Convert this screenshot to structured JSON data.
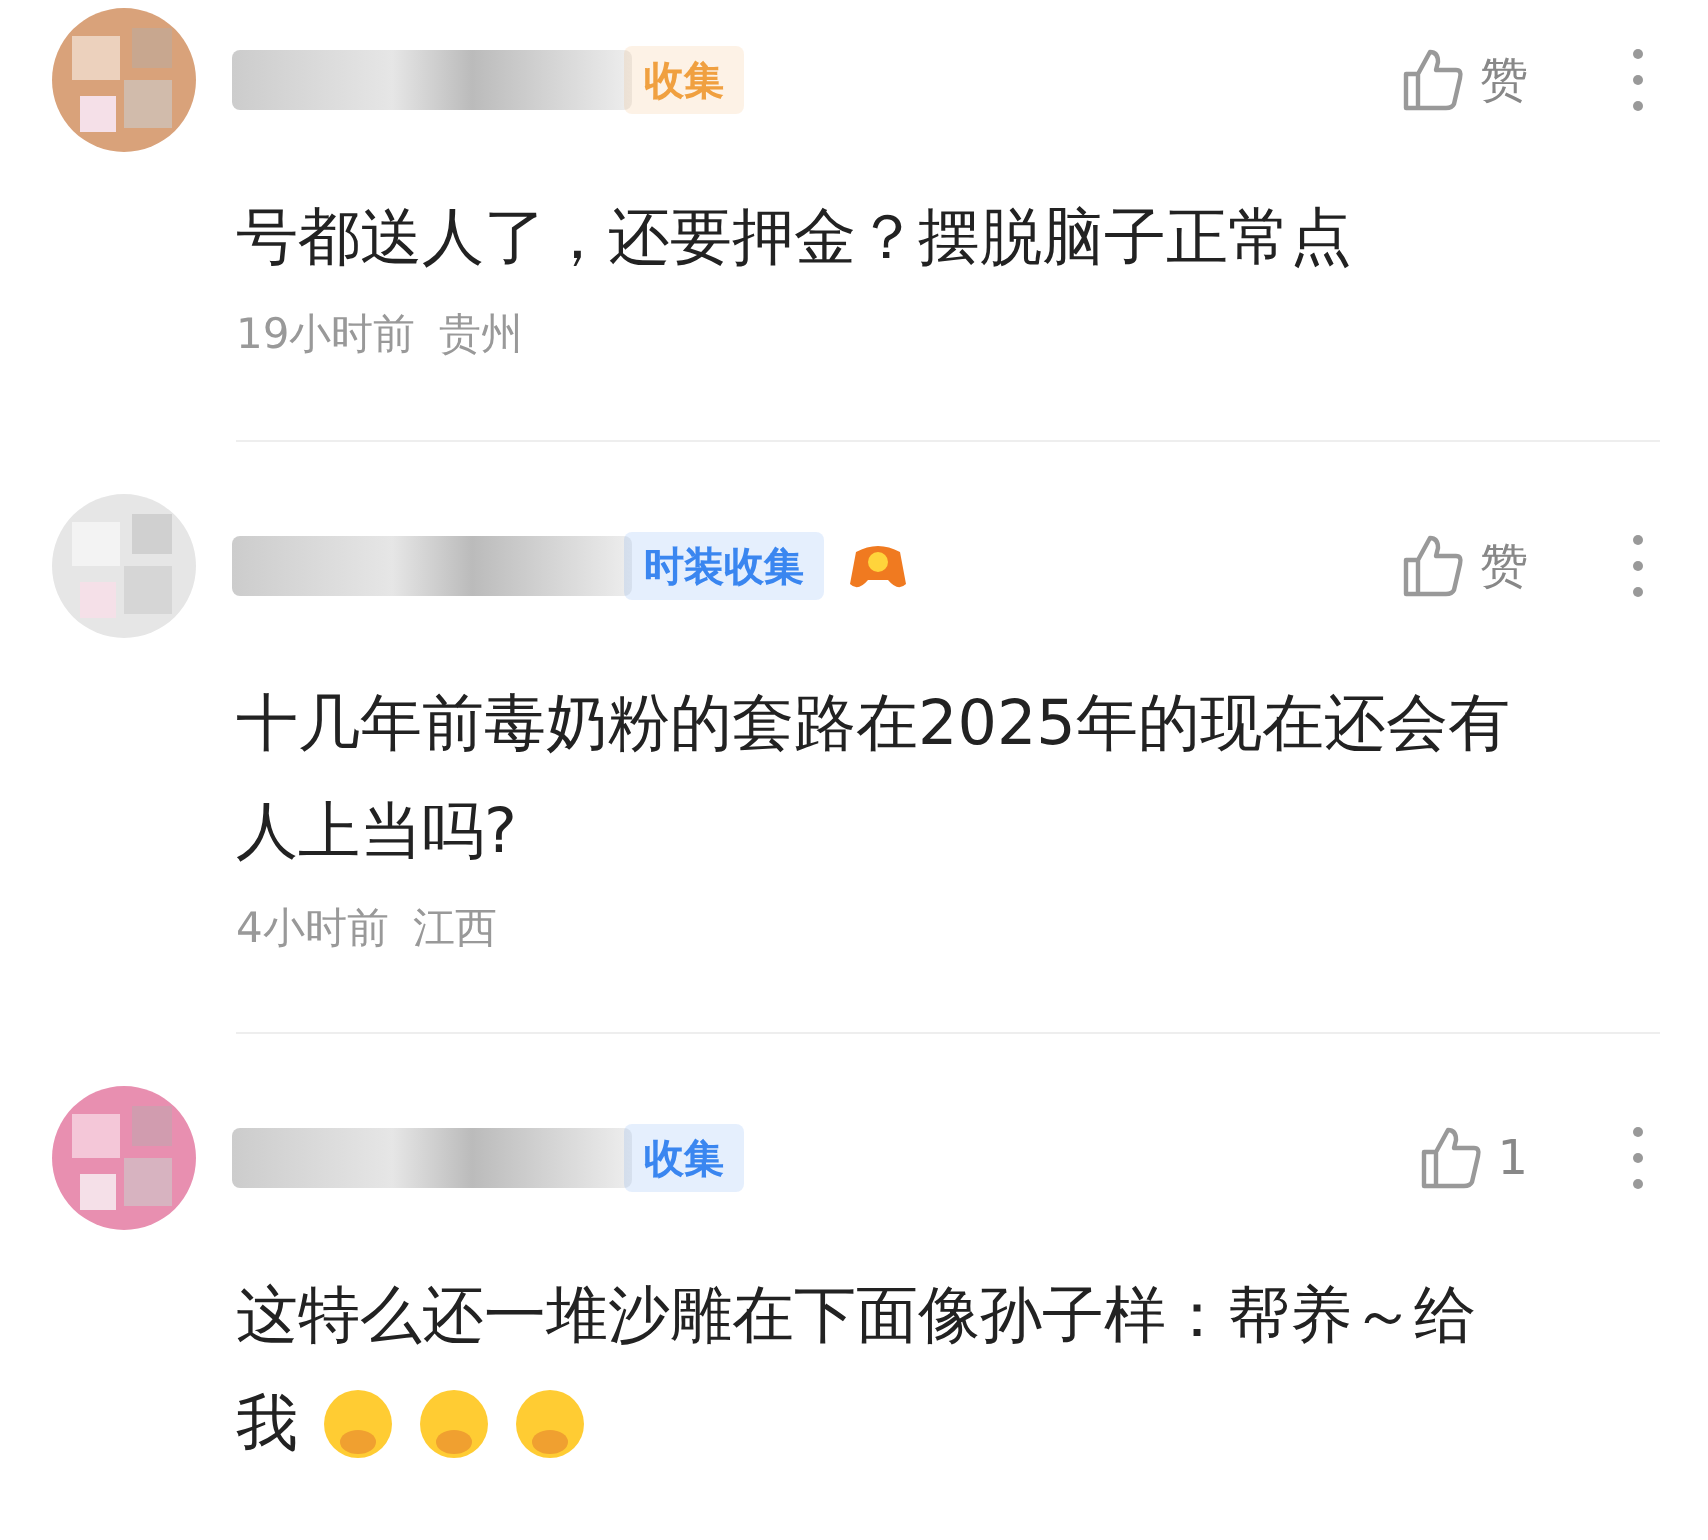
{
  "comments": [
    {
      "badge": {
        "text": "收集",
        "color": "#f0a040"
      },
      "medal": false,
      "like": {
        "label": "赞"
      },
      "lines": [
        "号都送人了，还要押金？摆脱脑子正常点"
      ],
      "time": "19小时前",
      "region": "贵州"
    },
    {
      "badge": {
        "text": "时装收集",
        "color": "#3a86f0"
      },
      "medal": true,
      "like": {
        "label": "赞"
      },
      "lines": [
        "十几年前毒奶粉的套路在2025年的现在还会有",
        "人上当吗?"
      ],
      "time": "4小时前",
      "region": "江西"
    },
    {
      "badge": {
        "text": "收集",
        "color": "#3a86f0"
      },
      "medal": false,
      "like": {
        "label": "1"
      },
      "lines": [
        "这特么还一堆沙雕在下面像孙子样：帮养～给",
        "我"
      ],
      "emojis": [
        {
          "kind": "cover-mouth"
        },
        {
          "kind": "cover-mouth"
        },
        {
          "kind": "cover-mouth"
        }
      ]
    }
  ]
}
